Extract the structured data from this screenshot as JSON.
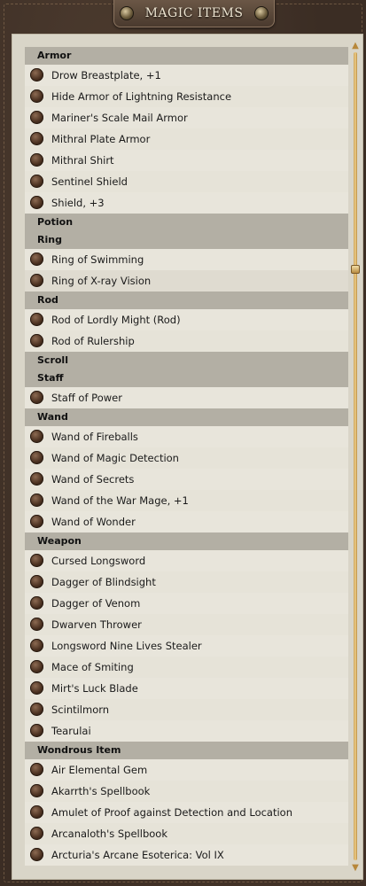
{
  "title": "MAGIC ITEMS",
  "sections": [
    {
      "category": "Armor",
      "items": [
        "Drow Breastplate, +1",
        "Hide Armor of Lightning Resistance",
        "Mariner's Scale Mail Armor",
        "Mithral Plate Armor",
        "Mithral Shirt",
        "Sentinel Shield",
        "Shield, +3"
      ]
    },
    {
      "category": "Potion",
      "items": []
    },
    {
      "category": "Ring",
      "items": [
        "Ring of Swimming",
        "Ring of X-ray Vision"
      ]
    },
    {
      "category": "Rod",
      "items": [
        "Rod of Lordly Might (Rod)",
        "Rod of Rulership"
      ]
    },
    {
      "category": "Scroll",
      "items": []
    },
    {
      "category": "Staff",
      "items": [
        "Staff of Power"
      ]
    },
    {
      "category": "Wand",
      "items": [
        "Wand of Fireballs",
        "Wand of Magic Detection",
        "Wand of Secrets",
        "Wand of the War Mage, +1",
        "Wand of Wonder"
      ]
    },
    {
      "category": "Weapon",
      "items": [
        "Cursed Longsword",
        "Dagger of Blindsight",
        "Dagger of Venom",
        "Dwarven Thrower",
        "Longsword Nine Lives Stealer",
        "Mace of Smiting",
        "Mirt's Luck Blade",
        "Scintilmorn",
        "Tearulai"
      ]
    },
    {
      "category": "Wondrous Item",
      "items": [
        "Air Elemental Gem",
        "Akarrth's Spellbook",
        "Amulet of Proof against Detection and Location",
        "Arcanaloth's Spellbook",
        "Arcturia's Arcane Esoterica: Vol IX"
      ]
    }
  ],
  "colors": {
    "frame": "#3b2d24",
    "panel": "#d9d5c8",
    "category_bar": "#b3afa4",
    "scroll_gold": "#c89d55"
  },
  "icons": {
    "bullet": "item-bullet-icon",
    "stud": "stud-icon"
  }
}
